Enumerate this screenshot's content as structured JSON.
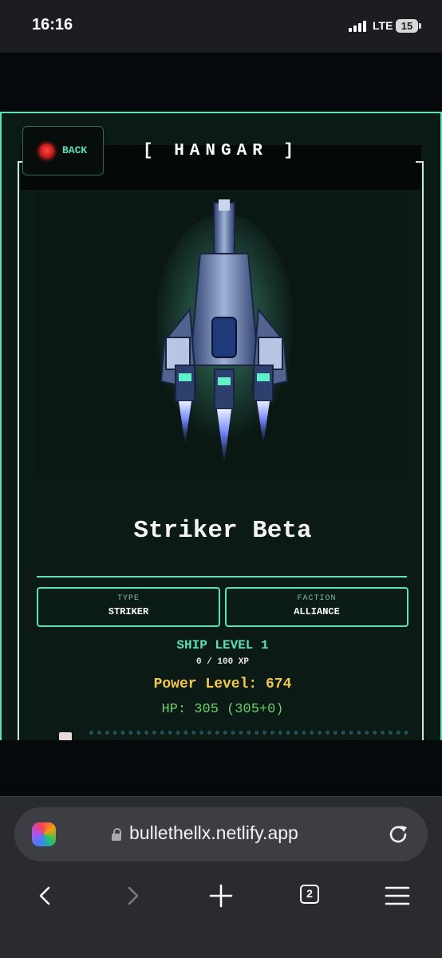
{
  "status_bar": {
    "time": "16:16",
    "network": "LTE",
    "battery": "15"
  },
  "header": {
    "back_label": "BACK",
    "title": "[ HANGAR ]"
  },
  "ship": {
    "name": "Striker Beta",
    "type_label": "TYPE",
    "type_value": "STRIKER",
    "faction_label": "FACTION",
    "faction_value": "ALLIANCE",
    "level": "SHIP LEVEL 1",
    "xp": "0 / 100 XP",
    "power": "Power Level: 674",
    "hp": "HP: 305 (305+0)"
  },
  "browser": {
    "url": "bullethellx.netlify.app",
    "tab_count": "2"
  },
  "colors": {
    "accent": "#5be0b3",
    "power": "#f2c94c",
    "hp": "#6ccf6e",
    "back_dot": "#e02424"
  }
}
